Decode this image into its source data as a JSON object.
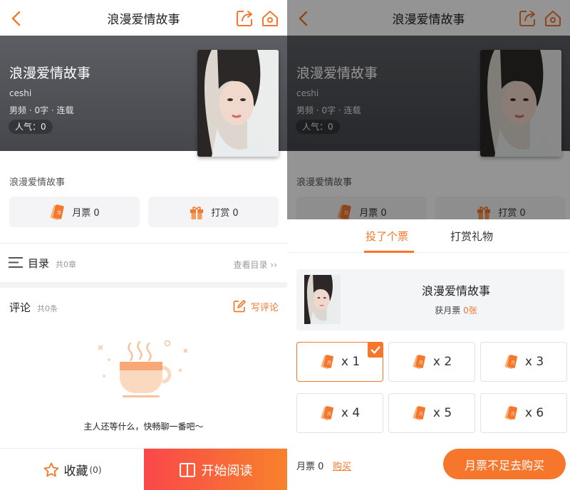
{
  "app": {
    "title": "浪漫爱情故事"
  },
  "book": {
    "title": "浪漫爱情故事",
    "author": "ceshi",
    "meta": "男频 · 0字 · 连载",
    "popularity": "人气：0",
    "description": "浪漫爱情故事"
  },
  "actions": {
    "monthly_ticket": "月票 0",
    "reward": "打赏 0"
  },
  "toc": {
    "label": "目录",
    "count": "共0章",
    "link": "查看目录"
  },
  "comments": {
    "label": "评论",
    "count": "共0条",
    "write": "写评论",
    "empty": "主人还等什么，快畅聊一番吧～"
  },
  "bottom": {
    "favorite": "收藏",
    "favorite_count": "(0)",
    "read": "开始阅读"
  },
  "vote_sheet": {
    "tabs": [
      {
        "label": "投了个票"
      },
      {
        "label": "打赏礼物"
      }
    ],
    "card_title": "浪漫爱情故事",
    "card_sub_prefix": "获月票 ",
    "card_sub_value": "0张",
    "options": [
      {
        "label": "x 1",
        "selected": true
      },
      {
        "label": "x 2",
        "selected": false
      },
      {
        "label": "x 3",
        "selected": false
      },
      {
        "label": "x 4",
        "selected": false
      },
      {
        "label": "x 5",
        "selected": false
      },
      {
        "label": "x 6",
        "selected": false
      }
    ],
    "balance": "月票 0",
    "buy_link": "购买",
    "buy_button": "月票不足去购买"
  },
  "icons": {
    "back": "chevron-left-icon",
    "share": "share-icon",
    "home": "home-icon",
    "ticket": "ticket-icon",
    "gift": "gift-icon",
    "menu": "menu-list-icon",
    "edit": "edit-icon",
    "star": "star-icon",
    "book": "book-open-icon"
  },
  "colors": {
    "accent": "#f6772c",
    "read_gradient_start": "#f9484a",
    "read_gradient_end": "#f8812b"
  }
}
